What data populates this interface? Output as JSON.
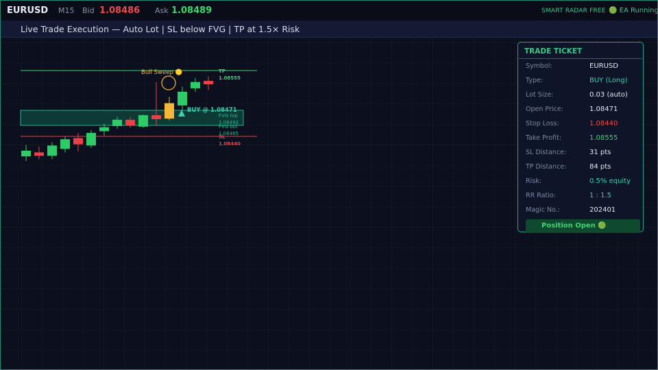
{
  "topbar": {
    "symbol": "EURUSD",
    "timeframe": "M15",
    "bid_label": "Bid",
    "bid_value": "1.08486",
    "ask_label": "Ask",
    "ask_value": "1.08489",
    "radar_label": "SMART RADAR  FREE",
    "ea_status": "🟢 EA Running"
  },
  "banner": {
    "text": "Live Trade Execution  —  Auto Lot  |  SL below FVG  |  TP at 1.5× Risk"
  },
  "chart": {
    "tp_label": "TP",
    "tp_value": "1.08555",
    "fvg_top_label": "FVG top",
    "fvg_top_value": "1.08492",
    "fvg_bot_label": "FVG bot",
    "fvg_bot_value": "1.08465",
    "sl_label": "SL",
    "sl_value": "1.08440",
    "sweep_label": "Bull Sweep 🟡",
    "entry_label": "BUY @ 1.08471"
  },
  "colors": {
    "bull": "#2ecc66",
    "bear": "#e8414a",
    "signal": "#f4b73a",
    "tp_line": "#3ed66f",
    "sl_line": "#e8414a",
    "fvg_zone": "#0d3a35",
    "accent": "#23a48c"
  },
  "candles": [
    {
      "o": 1.08415,
      "h": 1.08425,
      "l": 1.08397,
      "c": 1.08405,
      "dir": "bull"
    },
    {
      "o": 1.08412,
      "h": 1.08422,
      "l": 1.084,
      "c": 1.08406,
      "dir": "bear"
    },
    {
      "o": 1.08406,
      "h": 1.0843,
      "l": 1.084,
      "c": 1.08424,
      "dir": "bull"
    },
    {
      "o": 1.08418,
      "h": 1.0844,
      "l": 1.08412,
      "c": 1.08435,
      "dir": "bull"
    },
    {
      "o": 1.08437,
      "h": 1.08446,
      "l": 1.08414,
      "c": 1.08426,
      "dir": "bear"
    },
    {
      "o": 1.08424,
      "h": 1.08451,
      "l": 1.0842,
      "c": 1.08446,
      "dir": "bull"
    },
    {
      "o": 1.08449,
      "h": 1.08462,
      "l": 1.08441,
      "c": 1.08456,
      "dir": "bull"
    },
    {
      "o": 1.08458,
      "h": 1.08474,
      "l": 1.08453,
      "c": 1.08469,
      "dir": "bull"
    },
    {
      "o": 1.08469,
      "h": 1.08474,
      "l": 1.08455,
      "c": 1.08459,
      "dir": "bear"
    },
    {
      "o": 1.08457,
      "h": 1.08478,
      "l": 1.08455,
      "c": 1.08477,
      "dir": "bull"
    },
    {
      "o": 1.08477,
      "h": 1.08535,
      "l": 1.08459,
      "c": 1.0847,
      "dir": "bear"
    },
    {
      "o": 1.08471,
      "h": 1.08509,
      "l": 1.08468,
      "c": 1.08498,
      "dir": "signal"
    },
    {
      "o": 1.08494,
      "h": 1.08527,
      "l": 1.08485,
      "c": 1.08518,
      "dir": "bull"
    },
    {
      "o": 1.08524,
      "h": 1.08542,
      "l": 1.08518,
      "c": 1.08535,
      "dir": "bull"
    },
    {
      "o": 1.08537,
      "h": 1.08545,
      "l": 1.08521,
      "c": 1.08531,
      "dir": "bear"
    }
  ],
  "ticket": {
    "title": "TRADE TICKET",
    "rows": [
      {
        "key": "Symbol:",
        "value": "EURUSD",
        "tone": "white"
      },
      {
        "key": "Type:",
        "value": "BUY (Long)",
        "tone": "teal"
      },
      {
        "key": "Lot Size:",
        "value": "0.03 (auto)",
        "tone": "white"
      },
      {
        "key": "Open Price:",
        "value": "1.08471",
        "tone": "white"
      },
      {
        "key": "Stop Loss:",
        "value": "1.08440",
        "tone": "red"
      },
      {
        "key": "Take Profit:",
        "value": "1.08555",
        "tone": "green"
      },
      {
        "key": "SL Distance:",
        "value": "31 pts",
        "tone": "white"
      },
      {
        "key": "TP Distance:",
        "value": "84 pts",
        "tone": "white"
      },
      {
        "key": "Risk:",
        "value": "0.5% equity",
        "tone": "teal"
      },
      {
        "key": "RR Ratio:",
        "value": "1 : 1.5",
        "tone": "teal"
      },
      {
        "key": "Magic No.:",
        "value": "202401",
        "tone": "white"
      }
    ],
    "status_button": "Position Open 🟢"
  }
}
